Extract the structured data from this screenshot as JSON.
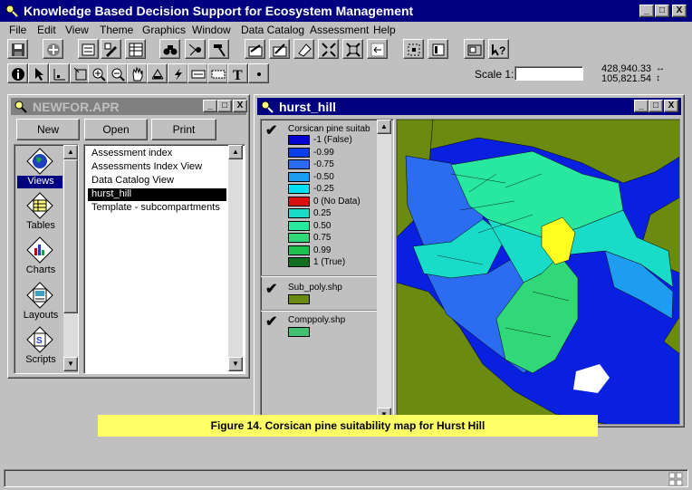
{
  "app": {
    "title": "Knowledge Based Decision Support for Ecosystem Management",
    "controls": {
      "minimize": "_",
      "maximize": "□",
      "close": "X"
    }
  },
  "menu": [
    "File",
    "Edit",
    "View",
    "Theme",
    "Graphics",
    "Window",
    "Data Catalog",
    "Assessment",
    "Help"
  ],
  "toolbar": {
    "buttons": [
      "save-icon",
      "add-theme-icon",
      "theme-properties-icon",
      "edit-legend-icon",
      "table-icon",
      "find-icon",
      "locate-icon",
      "hammer-icon",
      "add-feature-icon",
      "edit-icon",
      "erase-icon",
      "zoom-extent-icon",
      "zoom-active-icon",
      "zoom-previous-icon",
      "zoom-selected-icon",
      "select-none-icon",
      "layout-icon",
      "help-icon"
    ]
  },
  "tools": {
    "buttons": [
      "info-icon",
      "pointer-icon",
      "vertex-icon",
      "select-feature-icon",
      "zoom-in-icon",
      "zoom-out-icon",
      "pan-icon",
      "measure-icon",
      "hotlink-icon",
      "label-icon",
      "text-label-icon",
      "text-icon",
      "point-icon"
    ],
    "scale_label": "Scale 1:",
    "scale_value": "",
    "coord_x": "428,940.33",
    "coord_y": "105,821.54"
  },
  "project_window": {
    "title": "NEWFOR.APR",
    "buttons": {
      "new": "New",
      "open": "Open",
      "print": "Print"
    },
    "doc_types": [
      {
        "label": "Views",
        "icon": "globe-icon",
        "selected": true
      },
      {
        "label": "Tables",
        "icon": "table-icon",
        "selected": false
      },
      {
        "label": "Charts",
        "icon": "chart-icon",
        "selected": false
      },
      {
        "label": "Layouts",
        "icon": "layout-icon",
        "selected": false
      },
      {
        "label": "Scripts",
        "icon": "script-icon",
        "selected": false
      }
    ],
    "documents": [
      {
        "label": "Assessment index",
        "selected": false
      },
      {
        "label": "Assessments Index View",
        "selected": false
      },
      {
        "label": "Data Catalog View",
        "selected": false
      },
      {
        "label": "hurst_hill",
        "selected": true
      },
      {
        "label": "Template - subcompartments",
        "selected": false
      }
    ]
  },
  "view_window": {
    "title": "hurst_hill",
    "themes": [
      {
        "name": "Corsican pine suitab",
        "checked": true,
        "legend": [
          {
            "label": "-1 (False)",
            "color": "#0000d0"
          },
          {
            "label": "-0.99",
            "color": "#0a3ee8"
          },
          {
            "label": "-0.75",
            "color": "#2c6cf0"
          },
          {
            "label": "-0.50",
            "color": "#1e9cf0"
          },
          {
            "label": "-0.25",
            "color": "#00e0f8"
          },
          {
            "label": "0 (No Data)",
            "color": "#d81010"
          },
          {
            "label": "0.25",
            "color": "#18dcc8"
          },
          {
            "label": "0.50",
            "color": "#28e8a0"
          },
          {
            "label": "0.75",
            "color": "#30d878"
          },
          {
            "label": "0.99",
            "color": "#20c050"
          },
          {
            "label": "1 (True)",
            "color": "#107020"
          }
        ]
      },
      {
        "name": "Sub_poly.shp",
        "checked": true,
        "color": "#6a8a10"
      },
      {
        "name": "Comppoly.shp",
        "checked": true,
        "color": "#40c070"
      }
    ],
    "map_colors": {
      "background": "#0a20e0",
      "green": "#6a8a10",
      "white": "#ffffff"
    }
  },
  "caption": "Figure 14. Corsican pine suitability map for Hurst Hill"
}
